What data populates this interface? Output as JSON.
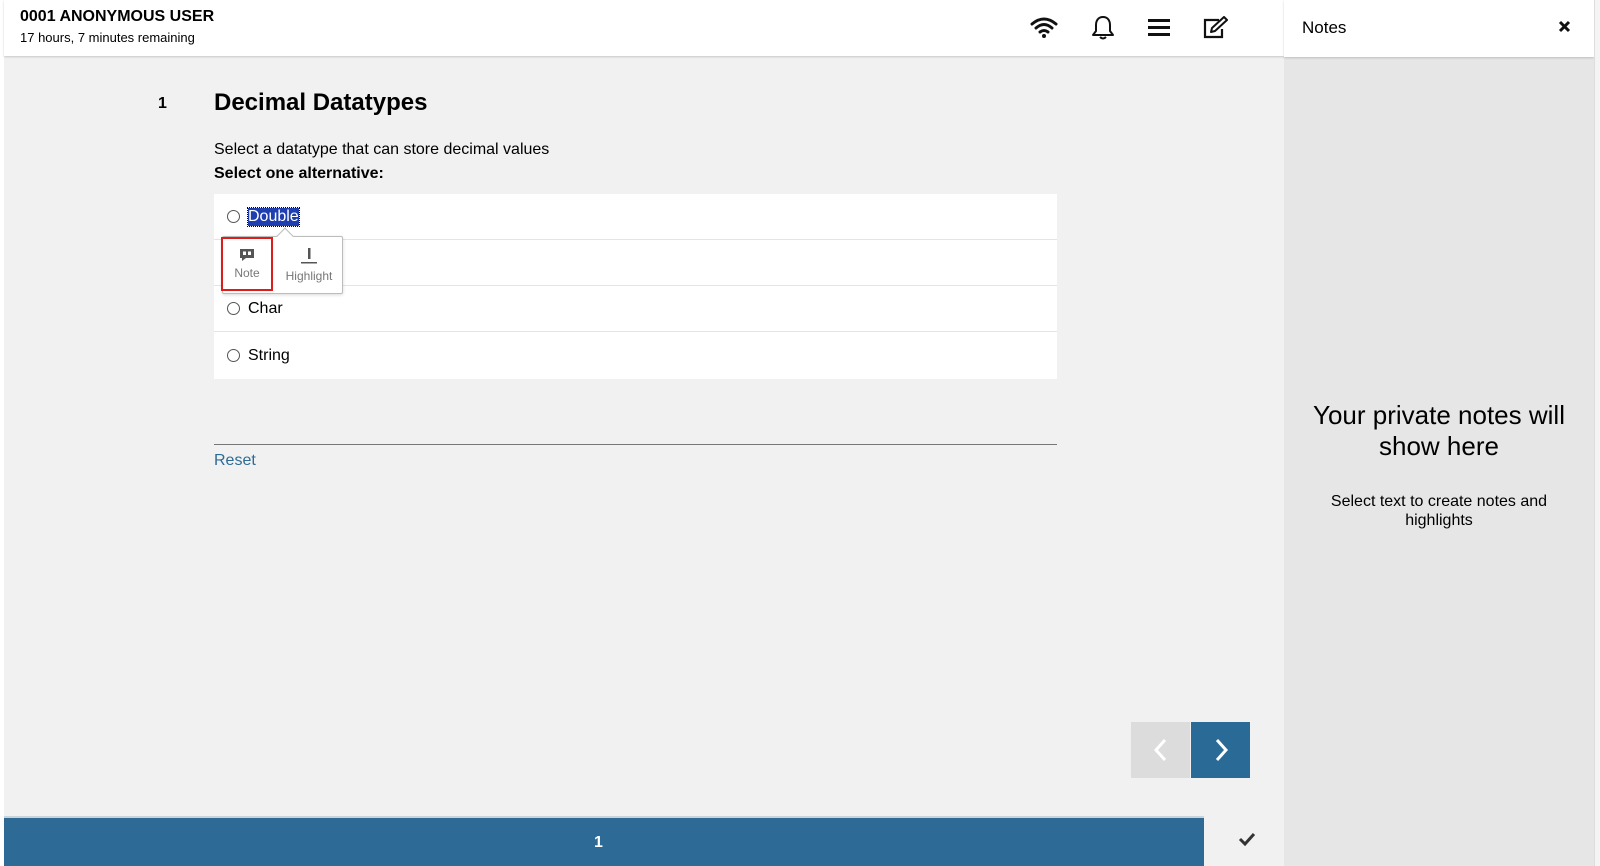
{
  "header": {
    "user_name": "0001 ANONYMOUS USER",
    "time_remaining": "17 hours, 7 minutes remaining"
  },
  "question": {
    "number": "1",
    "title": "Decimal Datatypes",
    "text": "Select a datatype that can store decimal values",
    "instruction": "Select one alternative:",
    "options": [
      {
        "label": "Double",
        "selected_text": true
      },
      {
        "label": ""
      },
      {
        "label": "Char"
      },
      {
        "label": "String"
      }
    ],
    "reset_label": "Reset"
  },
  "popup": {
    "note_label": "Note",
    "highlight_label": "Highlight"
  },
  "footer": {
    "page_number": "1"
  },
  "notes_panel": {
    "title": "Notes",
    "empty_title": "Your private notes will show here",
    "empty_subtitle": "Select text to create notes and highlights"
  },
  "colors": {
    "accent": "#2d6b96",
    "selection": "#1f3fb0",
    "note_outline": "#dd1c1c"
  },
  "icons": [
    "wifi-icon",
    "bell-icon",
    "menu-icon",
    "edit-icon",
    "close-icon",
    "quote-icon",
    "highlight-icon",
    "chevron-left-icon",
    "chevron-right-icon",
    "check-icon"
  ]
}
